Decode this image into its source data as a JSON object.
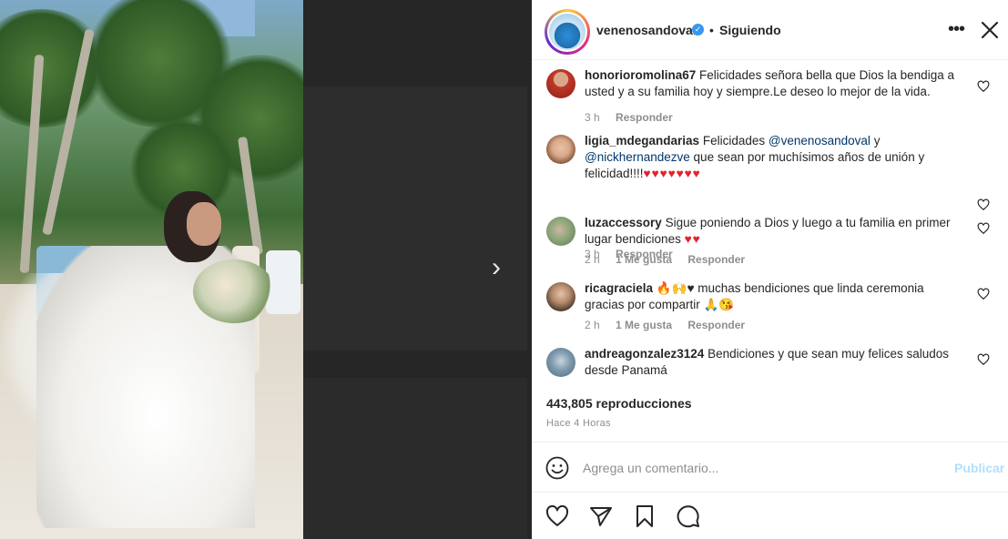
{
  "post": {
    "username": "venenosandoval",
    "separator": "•",
    "follow_status": "Siguiendo",
    "more_glyph": "•••",
    "views": "443,805 reproducciones",
    "time_ago": "Hace 4 Horas"
  },
  "comments": [
    {
      "user": "honorioromolina67",
      "text": "Felicidades señora bella que Dios la bendiga a usted y a su familia hoy y siempre.Le deseo lo mejor de la vida.",
      "time": "3 h",
      "likes": "",
      "reply": "Responder",
      "avatar_color": "#c0392b"
    },
    {
      "user": "ligia_mdegandarias",
      "text_before": "Felicidades",
      "mention1": "@venenosandoval",
      "text_mid": "y",
      "mention2": "@nickhernandezve",
      "text_after": "que sean por muchísimos años de unión y felicidad!!!!",
      "emoji": "♥♥♥♥♥♥♥",
      "time": "3 h",
      "likes": "",
      "reply": "Responder",
      "avatar_color": "#c8a07a"
    },
    {
      "user": "luzaccessory",
      "text": "Sigue poniendo a Dios y luego a tu familia en primer lugar bendiciones",
      "emoji": "♥♥",
      "time": "2 h",
      "likes": "1 Me gusta",
      "reply": "Responder",
      "avatar_color": "#7a8f6a"
    },
    {
      "user": "ricagraciela",
      "emoji_lead": "🔥🙌♥",
      "text": "muchas bendiciones que linda ceremonia gracias por compartir",
      "emoji_tail": "🙏😘",
      "time": "2 h",
      "likes": "1 Me gusta",
      "reply": "Responder",
      "avatar_color": "#6b5a4a"
    },
    {
      "user": "andreagonzalez3124",
      "text": "Bendiciones y que sean muy felices saludos desde Panamá",
      "avatar_color": "#5d7a8c"
    }
  ],
  "composer": {
    "placeholder": "Agrega un comentario...",
    "publish": "Publicar"
  },
  "nav": {
    "next_glyph": "›"
  },
  "colors": {
    "accent_blue": "#3897f0",
    "publish_disabled": "#b2dffc",
    "heart_red": "#e0232e"
  }
}
